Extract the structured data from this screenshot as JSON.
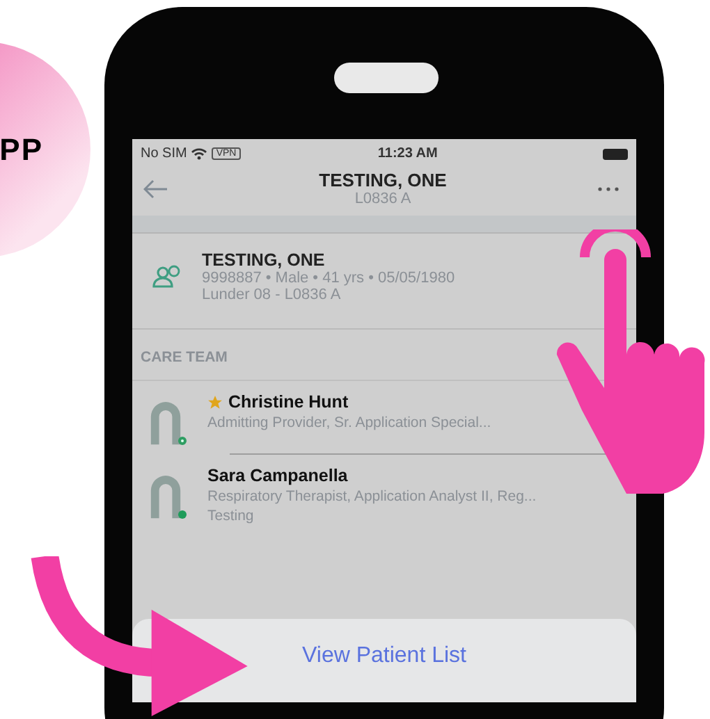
{
  "logo": {
    "letters": "PP"
  },
  "status_bar": {
    "carrier": "No SIM",
    "vpn": "VPN",
    "time": "11:23 AM"
  },
  "header": {
    "title": "TESTING, ONE",
    "subtitle": "L0836 A"
  },
  "patient": {
    "name": "TESTING, ONE",
    "details": "9998887 • Male • 41 yrs • 05/05/1980",
    "location": "Lunder 08 - L0836 A"
  },
  "care_team": {
    "heading": "CARE TEAM",
    "members": [
      {
        "name": "Christine Hunt",
        "role": "Admitting Provider, Sr. Application Special...",
        "starred": true,
        "active": false
      },
      {
        "name": "Sara Campanella",
        "role": "Respiratory Therapist, Application Analyst II, Reg...",
        "note": "Testing",
        "starred": false,
        "active": true
      }
    ]
  },
  "action": {
    "label": "View Patient List"
  }
}
